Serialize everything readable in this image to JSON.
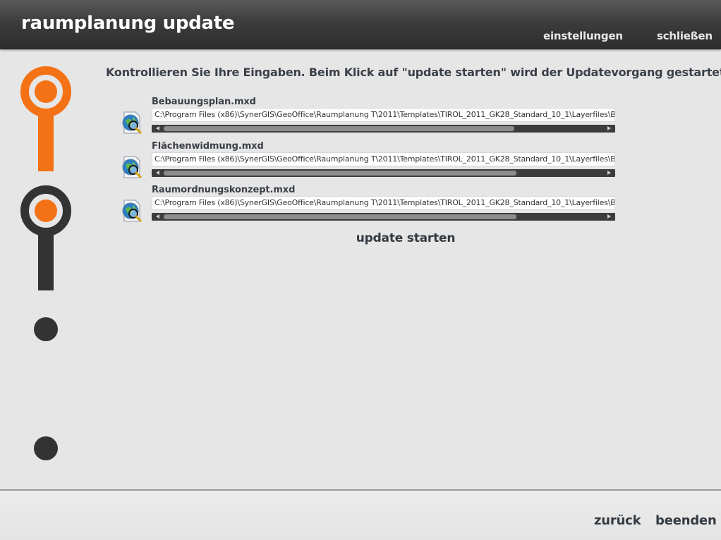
{
  "header": {
    "title": "raumplanung update",
    "settings_label": "einstellungen",
    "close_label": "schließen"
  },
  "stepper": {
    "accent_color": "#f47216",
    "inactive_color": "#333333",
    "steps": [
      {
        "state": "completed"
      },
      {
        "state": "current"
      },
      {
        "state": "pending"
      },
      {
        "state": "pending"
      }
    ]
  },
  "main": {
    "instruction": "Kontrollieren Sie Ihre Eingaben. Beim Klick auf \"update starten\" wird der Updatevorgang gestartet.",
    "files": [
      {
        "name": "Bebauungsplan.mxd",
        "path": "C:\\Program Files (x86)\\SynerGIS\\GeoOffice\\Raumplanung T\\2011\\Templates\\TIROL_2011_GK28_Standard_10_1\\Layerfiles\\BEBAUUNGSPLAN\\Bebauungsplan.mxd",
        "icon": "mxd-map-document-icon"
      },
      {
        "name": "Flächenwidmung.mxd",
        "path": "C:\\Program Files (x86)\\SynerGIS\\GeoOffice\\Raumplanung T\\2011\\Templates\\TIROL_2011_GK28_Standard_10_1\\Layerfiles\\BEBAUUNGSPLAN\\Flächenwidmung.mxd",
        "icon": "mxd-map-document-icon"
      },
      {
        "name": "Raumordnungskonzept.mxd",
        "path": "C:\\Program Files (x86)\\SynerGIS\\GeoOffice\\Raumplanung T\\2011\\Templates\\TIROL_2011_GK28_Standard_10_1\\Layerfiles\\BEBAUUNGSPLAN\\Raumordnungskonzept.mxd",
        "icon": "mxd-map-document-icon"
      }
    ],
    "update_label": "update starten"
  },
  "footer": {
    "back_label": "zurück",
    "finish_label": "beenden"
  }
}
